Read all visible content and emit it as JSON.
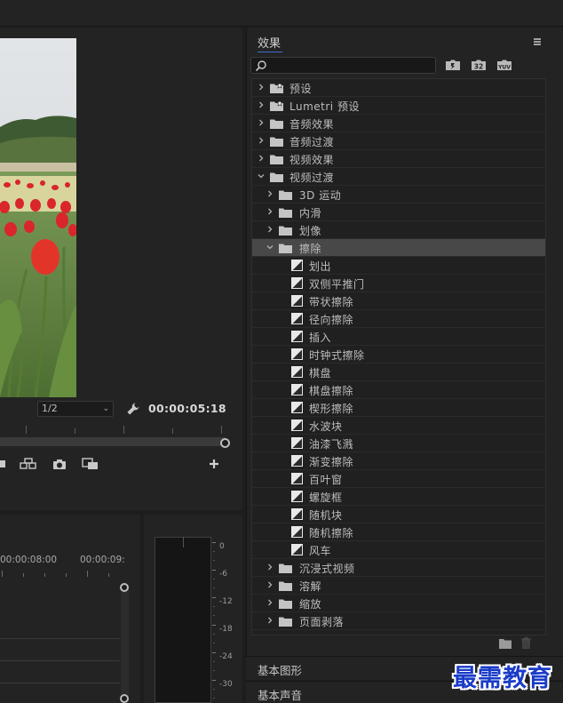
{
  "program_monitor": {
    "zoom": "1/2",
    "timecode": "00:00:05:18"
  },
  "timeline": {
    "ruler_labels": [
      "00:00:08:00",
      "00:00:09:"
    ]
  },
  "audio_meter": {
    "db_labels": [
      "0",
      "-6",
      "-12",
      "-18",
      "-24",
      "-30"
    ]
  },
  "effects": {
    "title": "效果",
    "search_placeholder": "",
    "filter_buttons": [
      {
        "icon": "accelerated-effects-icon",
        "text": ""
      },
      {
        "icon": "32bit-effects-icon",
        "text": "32"
      },
      {
        "icon": "yuv-effects-icon",
        "text": "YUV"
      }
    ],
    "tree": [
      {
        "label": "预设",
        "level": 0,
        "kind": "preset-folder",
        "expanded": false
      },
      {
        "label": "Lumetri 预设",
        "level": 0,
        "kind": "preset-folder",
        "expanded": false
      },
      {
        "label": "音频效果",
        "level": 0,
        "kind": "folder",
        "expanded": false
      },
      {
        "label": "音频过渡",
        "level": 0,
        "kind": "folder",
        "expanded": false
      },
      {
        "label": "视频效果",
        "level": 0,
        "kind": "folder",
        "expanded": false
      },
      {
        "label": "视频过渡",
        "level": 0,
        "kind": "folder",
        "expanded": true
      },
      {
        "label": "3D 运动",
        "level": 1,
        "kind": "folder",
        "expanded": false
      },
      {
        "label": "内滑",
        "level": 1,
        "kind": "folder",
        "expanded": false
      },
      {
        "label": "划像",
        "level": 1,
        "kind": "folder",
        "expanded": false
      },
      {
        "label": "擦除",
        "level": 1,
        "kind": "folder",
        "expanded": true,
        "selected": true
      },
      {
        "label": "划出",
        "level": 2,
        "kind": "effect"
      },
      {
        "label": "双侧平推门",
        "level": 2,
        "kind": "effect"
      },
      {
        "label": "带状擦除",
        "level": 2,
        "kind": "effect"
      },
      {
        "label": "径向擦除",
        "level": 2,
        "kind": "effect"
      },
      {
        "label": "插入",
        "level": 2,
        "kind": "effect"
      },
      {
        "label": "时钟式擦除",
        "level": 2,
        "kind": "effect"
      },
      {
        "label": "棋盘",
        "level": 2,
        "kind": "effect"
      },
      {
        "label": "棋盘擦除",
        "level": 2,
        "kind": "effect"
      },
      {
        "label": "楔形擦除",
        "level": 2,
        "kind": "effect"
      },
      {
        "label": "水波块",
        "level": 2,
        "kind": "effect"
      },
      {
        "label": "油漆飞溅",
        "level": 2,
        "kind": "effect"
      },
      {
        "label": "渐变擦除",
        "level": 2,
        "kind": "effect"
      },
      {
        "label": "百叶窗",
        "level": 2,
        "kind": "effect"
      },
      {
        "label": "螺旋框",
        "level": 2,
        "kind": "effect"
      },
      {
        "label": "随机块",
        "level": 2,
        "kind": "effect"
      },
      {
        "label": "随机擦除",
        "level": 2,
        "kind": "effect"
      },
      {
        "label": "风车",
        "level": 2,
        "kind": "effect"
      },
      {
        "label": "沉浸式视频",
        "level": 1,
        "kind": "folder",
        "expanded": false
      },
      {
        "label": "溶解",
        "level": 1,
        "kind": "folder",
        "expanded": false
      },
      {
        "label": "缩放",
        "level": 1,
        "kind": "folder",
        "expanded": false
      },
      {
        "label": "页面剥落",
        "level": 1,
        "kind": "folder",
        "expanded": false
      }
    ]
  },
  "panels": {
    "essential_graphics": "基本图形",
    "essential_sound": "基本声音"
  },
  "watermark": "最需教育",
  "colors": {
    "panel_bg": "#232323",
    "selected_row": "#484848",
    "accent_underline": "#3b6ed0",
    "watermark": "#1a3cc8"
  }
}
